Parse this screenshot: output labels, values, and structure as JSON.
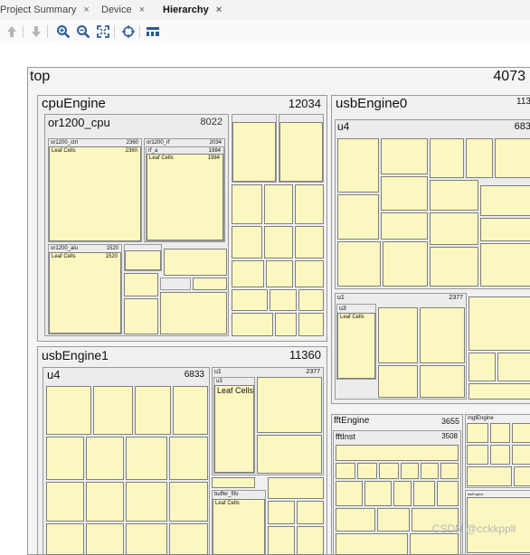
{
  "tabs": [
    {
      "label": "Project Summary",
      "close": "×"
    },
    {
      "label": "Device",
      "close": "×"
    },
    {
      "label": "Hierarchy",
      "close": "×"
    }
  ],
  "toolbar_icons": [
    "arrow-up-icon",
    "arrow-down-icon",
    "zoom-in-icon",
    "zoom-out-icon",
    "fit-to-window-icon",
    "crosshair-icon",
    "legend-icon"
  ],
  "tree": {
    "top": {
      "label": "top",
      "value": "4073"
    },
    "cpuEngine": {
      "label": "cpuEngine",
      "value": "12034"
    },
    "or1200_cpu": {
      "label": "or1200_cpu",
      "value": "8022"
    },
    "or1200_ctrl": {
      "label": "or1200_ctrl",
      "value": "2360"
    },
    "or1200_rf": {
      "label": "or1200_rf",
      "value": "2034"
    },
    "rf_a": {
      "label": "rf_a",
      "value": "1984"
    },
    "or1200_alu": {
      "label": "or1200_alu",
      "value": "1520"
    },
    "leaf_cells": "Leaf Cells",
    "leaf_cells_values": {
      "ctrl": "2360",
      "rf_a": "1984",
      "alu": "1520"
    },
    "usbEngine0": {
      "label": "usbEngine0",
      "value": "113"
    },
    "u4_0": {
      "label": "u4",
      "value": "683"
    },
    "u1_0": {
      "label": "u1",
      "value": "2377"
    },
    "u3_0": {
      "label": "u3"
    },
    "usbEngine1": {
      "label": "usbEngine1",
      "value": "11360"
    },
    "u4_1": {
      "label": "u4",
      "value": "6833"
    },
    "u1_1": {
      "label": "u1",
      "value": "2377"
    },
    "u3_1": {
      "label": "u3"
    },
    "buffer_fifo": {
      "label": "buffer_fifo"
    },
    "fftEngine": {
      "label": "fftEngine",
      "value": "3655"
    },
    "fftInst": {
      "label": "fftInst",
      "value": "3508"
    },
    "mgtEngine": {
      "label": "mgtEngine"
    },
    "fskEngine": {
      "label": "fskEngine"
    }
  },
  "watermark": "CSDN @cckkppll"
}
